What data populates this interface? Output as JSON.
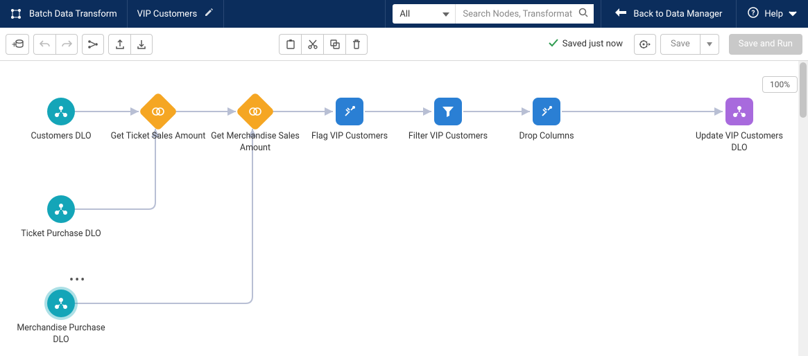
{
  "header": {
    "app_title": "Batch Data Transform",
    "file_name": "VIP Customers",
    "search_filter": "All",
    "search_placeholder": "Search Nodes, Transformat",
    "back_label": "Back to Data Manager",
    "help_label": "Help"
  },
  "toolbar": {
    "status_text": "Saved just now",
    "save_label": "Save",
    "save_run_label": "Save and Run"
  },
  "canvas": {
    "zoom": "100%"
  },
  "nodes": {
    "n0": "Customers DLO",
    "n1": "Get Ticket Sales Amount",
    "n2": "Get Merchandise Sales Amount",
    "n3": "Flag VIP Customers",
    "n4": "Filter VIP Customers",
    "n5": "Drop Columns",
    "n6": "Update VIP Customers DLO",
    "n7": "Ticket Purchase DLO",
    "n8": "Merchandise Purchase DLO"
  }
}
